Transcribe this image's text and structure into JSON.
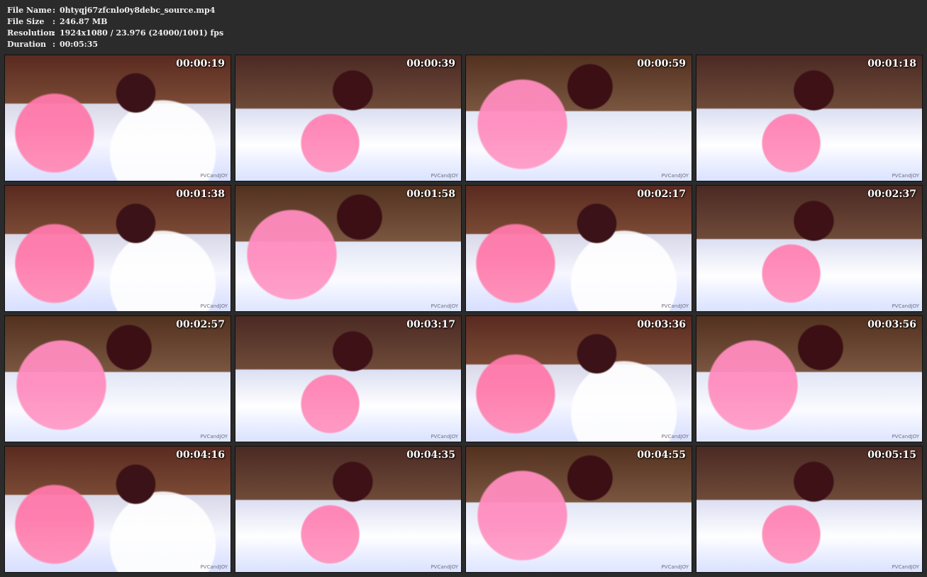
{
  "info": {
    "file_name_label": "File Name",
    "file_name_value": "0htyqj67zfcnlo0y8debc_source.mp4",
    "file_size_label": "File Size",
    "file_size_value": "246.87 MB",
    "resolution_label": "Resolution",
    "resolution_value": "1924x1080 / 23.976 (24000/1001) fps",
    "duration_label": "Duration",
    "duration_value": "00:05:35",
    "separator": ":"
  },
  "thumbs": [
    {
      "time": "00:00:19",
      "watermark": "PVCandJOY"
    },
    {
      "time": "00:00:39",
      "watermark": "PVCandJOY"
    },
    {
      "time": "00:00:59",
      "watermark": "PVCandJOY"
    },
    {
      "time": "00:01:18",
      "watermark": "PVCandJOY"
    },
    {
      "time": "00:01:38",
      "watermark": "PVCandJOY"
    },
    {
      "time": "00:01:58",
      "watermark": "PVCandJOY"
    },
    {
      "time": "00:02:17",
      "watermark": "PVCandJOY"
    },
    {
      "time": "00:02:37",
      "watermark": "PVCandJOY"
    },
    {
      "time": "00:02:57",
      "watermark": "PVCandJOY"
    },
    {
      "time": "00:03:17",
      "watermark": "PVCandJOY"
    },
    {
      "time": "00:03:36",
      "watermark": "PVCandJOY"
    },
    {
      "time": "00:03:56",
      "watermark": "PVCandJOY"
    },
    {
      "time": "00:04:16",
      "watermark": "PVCandJOY"
    },
    {
      "time": "00:04:35",
      "watermark": "PVCandJOY"
    },
    {
      "time": "00:04:55",
      "watermark": "PVCandJOY"
    },
    {
      "time": "00:05:15",
      "watermark": "PVCandJOY"
    }
  ]
}
